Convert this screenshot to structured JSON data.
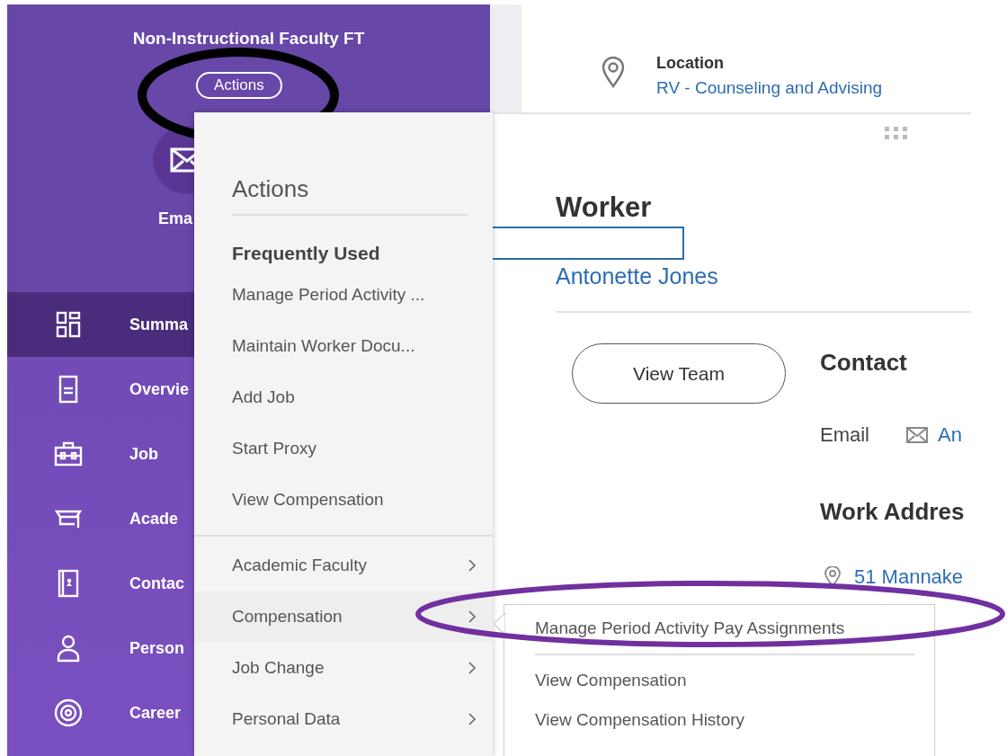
{
  "header": {
    "title": "Non-Instructional Faculty FT",
    "actions_button": "Actions",
    "email_label": "Ema"
  },
  "nav": [
    {
      "label": "Summa",
      "selected": true
    },
    {
      "label": "Overvie",
      "selected": false
    },
    {
      "label": "Job",
      "selected": false
    },
    {
      "label": "Acade",
      "selected": false
    },
    {
      "label": "Contac",
      "selected": false
    },
    {
      "label": "Person",
      "selected": false
    },
    {
      "label": "Career",
      "selected": false
    }
  ],
  "location": {
    "label": "Location",
    "value": "RV - Counseling and Advising"
  },
  "worker": {
    "heading": "Worker",
    "name": "Antonette Jones",
    "button": "View Team"
  },
  "contact": {
    "heading": "Contact",
    "email_label": "Email",
    "email_value": "An",
    "address_heading": "Work Addres",
    "address": "51 Mannake"
  },
  "actions_menu": {
    "title": "Actions",
    "section": "Frequently Used",
    "frequent": [
      "Manage Period Activity ...",
      "Maintain Worker Docu...",
      "Add Job",
      "Start Proxy",
      "View Compensation"
    ],
    "categories": [
      {
        "label": "Academic Faculty",
        "expanded": false
      },
      {
        "label": "Compensation",
        "expanded": true
      },
      {
        "label": "Job Change",
        "expanded": false
      },
      {
        "label": "Personal Data",
        "expanded": false
      }
    ]
  },
  "submenu": {
    "items": [
      "Manage Period Activity Pay Assignments",
      "View Compensation",
      "View Compensation History"
    ]
  }
}
